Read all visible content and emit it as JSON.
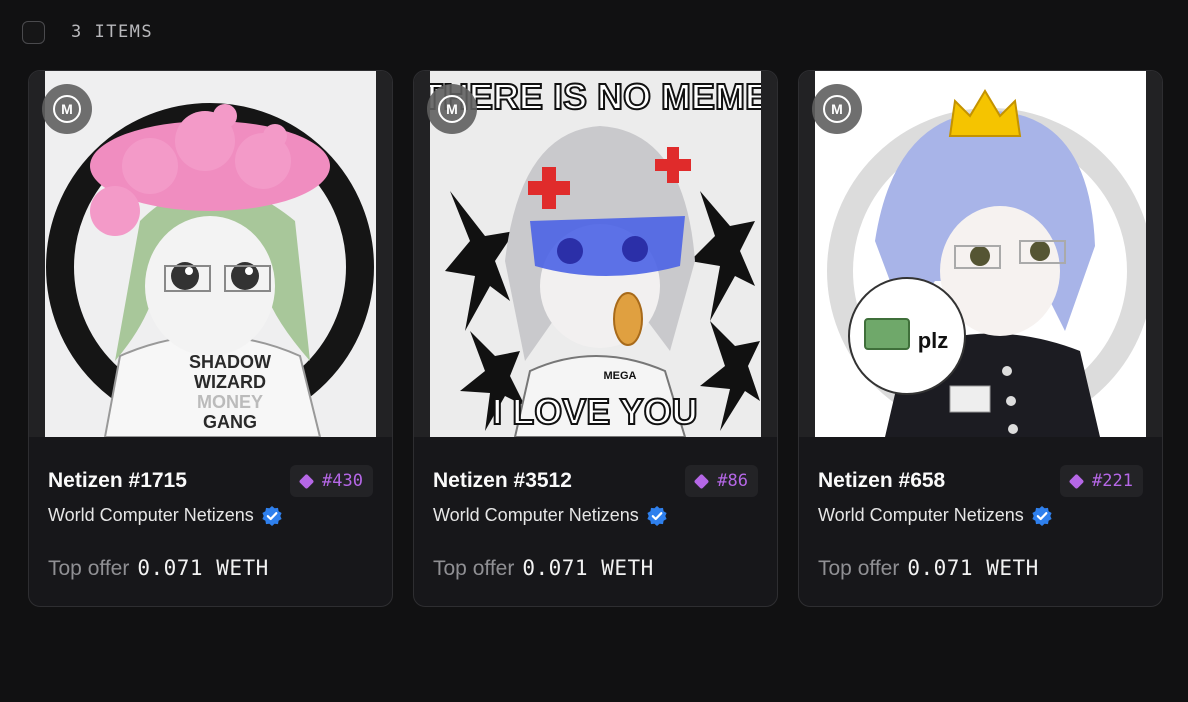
{
  "toolbar": {
    "item_count_label": "3 ITEMS"
  },
  "colors": {
    "background": "#111112",
    "card": "#17171a",
    "rank_accent": "#b567e6",
    "verified_blue": "#2f80ed"
  },
  "cards": [
    {
      "name": "Netizen #1715",
      "rank": "#430",
      "collection": "World Computer Netizens",
      "offer_label": "Top offer",
      "offer_value": "0.071 WETH",
      "art": {
        "banner": "",
        "shirt_text": [
          "SHADOW",
          "WIZARD",
          "MONEY",
          "GANG"
        ],
        "bottom_caption": ""
      }
    },
    {
      "name": "Netizen #3512",
      "rank": "#86",
      "collection": "World Computer Netizens",
      "offer_label": "Top offer",
      "offer_value": "0.071 WETH",
      "art": {
        "banner": "THERE IS NO MEME",
        "shirt_text": [
          "MEGA"
        ],
        "bottom_caption": "I LOVE YOU"
      }
    },
    {
      "name": "Netizen #658",
      "rank": "#221",
      "collection": "World Computer Netizens",
      "offer_label": "Top offer",
      "offer_value": "0.071 WETH",
      "art": {
        "banner": "",
        "speech_bubble": "plz",
        "bottom_caption": ""
      }
    }
  ],
  "icons": {
    "badge": "megaeth-logo-icon",
    "rank": "diamond-icon",
    "verified": "verified-badge-icon"
  }
}
